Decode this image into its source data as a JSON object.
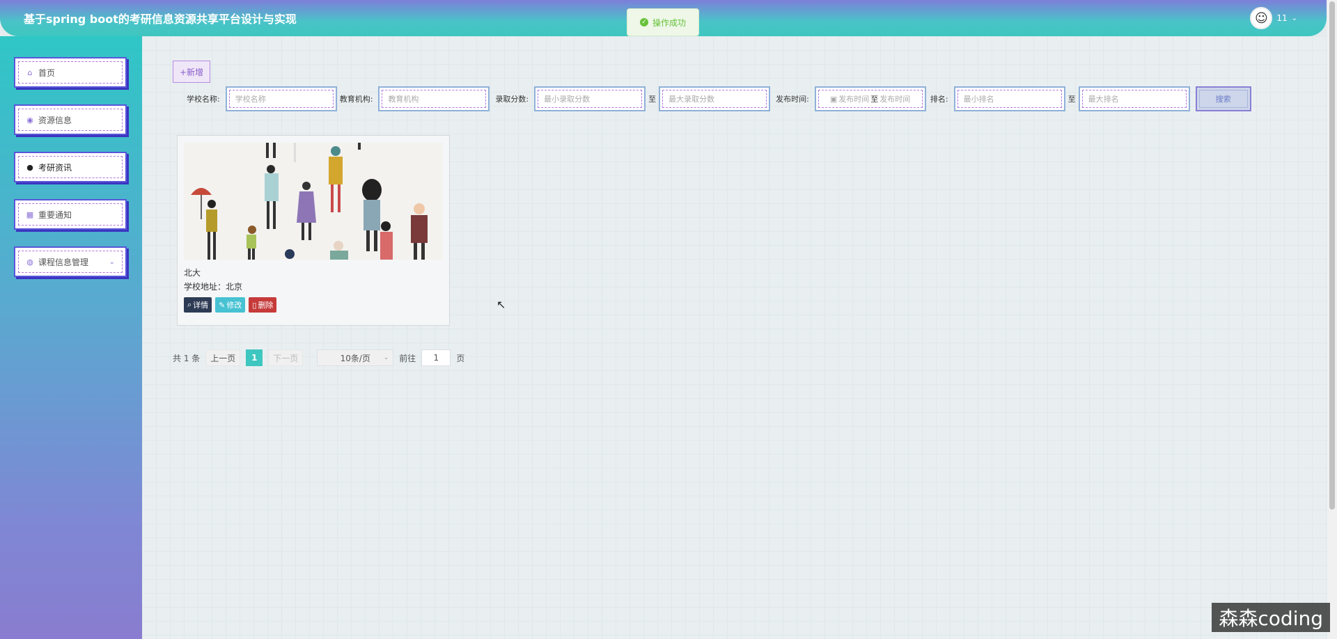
{
  "header": {
    "title": "基于spring boot的考研信息资源共享平台设计与实现",
    "toast": "操作成功",
    "user_name": "11"
  },
  "sidebar": {
    "items": [
      {
        "label": "首页",
        "icon": "home-icon"
      },
      {
        "label": "资源信息",
        "icon": "resource-icon"
      },
      {
        "label": "考研资讯",
        "icon": "news-icon",
        "active": true
      },
      {
        "label": "重要通知",
        "icon": "notice-icon"
      },
      {
        "label": "课程信息管理",
        "icon": "course-icon",
        "dropdown": true
      }
    ]
  },
  "toolbar": {
    "add_label": "+新增"
  },
  "filters": {
    "school_label": "学校名称:",
    "school_placeholder": "学校名称",
    "org_label": "教育机构:",
    "org_placeholder": "教育机构",
    "score_label": "录取分数:",
    "score_min_placeholder": "最小录取分数",
    "score_to": "至",
    "score_max_placeholder": "最大录取分数",
    "date_label": "发布时间:",
    "date_start": "发布时间",
    "date_to": "至",
    "date_end": "发布时间",
    "rank_label": "排名:",
    "rank_min_placeholder": "最小排名",
    "rank_to": "至",
    "rank_max_placeholder": "最大排名",
    "search_label": "搜索"
  },
  "cards": [
    {
      "name": "北大",
      "address": "学校地址：北京",
      "detail_label": "详情",
      "edit_label": "修改",
      "delete_label": "删除"
    }
  ],
  "pager": {
    "total": "共 1 条",
    "prev": "上一页",
    "current": "1",
    "next": "下一页",
    "size": "10条/页",
    "goto": "前往",
    "goto_value": "1",
    "page_unit": "页"
  },
  "watermark": "森森coding",
  "colors": {
    "accent": "#3ec6c0",
    "purple": "#5a55d9",
    "delete": "#c63a3a"
  }
}
